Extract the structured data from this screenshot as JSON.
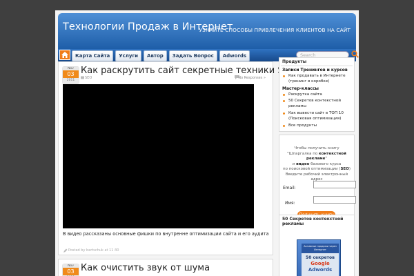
{
  "header": {
    "site_title": "Технологии Продаж в Интернет",
    "tagline": "УЗНАЙТЕ СПОСОБЫ ПРИВЛЕЧЕНИЯ КЛИЕНТОВ НА САЙТ"
  },
  "nav": {
    "items": [
      "Карта Сайта",
      "Услуги",
      "Автор",
      "Задать Вопрос",
      "Adwords"
    ],
    "search_placeholder": "Search"
  },
  "posts": [
    {
      "date": {
        "month": "Nov",
        "day": "03",
        "year": "2011"
      },
      "title": "Как раскрутить сайт секретные техники SEO",
      "tag": "SEO",
      "comments": "No Responses »",
      "excerpt": "В видео рассказаны основные фишки по внутренне оптимизации сайта и его аудита",
      "footer": "Posted by bertschuk at 11:30"
    },
    {
      "date": {
        "month": "Nov",
        "day": "03",
        "year": "2011"
      },
      "title": "Как очистить звук от шума"
    }
  ],
  "sidebar": {
    "products": {
      "title": "Продукты",
      "section1": "Записи Тренингов и курсов",
      "items1": [
        "Как продавать в Интернете (тренинг в коробке)"
      ],
      "section2": "Мастер-классы",
      "items2": [
        "Раскрутка сайта",
        "50 Секретов контекстной рекламы",
        "Как вывести сайт в ТОП 10 (Поисковая оптимизация)",
        "Все продукты"
      ]
    },
    "optin": {
      "line1": "Чтобы получить книгу",
      "line2a": "\"Шпаргалка по ",
      "line2b": "контекстной",
      "line3b": "рекламе",
      "line3a": "\"",
      "line4a": "и ",
      "line4b": "видео",
      "line4c": " базового курса",
      "line5": "по поисковой оптимизации (",
      "line5b": "SEO",
      "line5c": ")",
      "line6": "Введите рабочий электронный адрес",
      "email_label": "Email:",
      "name_label": "Имя:",
      "button": "Получить книгу"
    },
    "book": {
      "title": "50 Секретов контекстной рекламы",
      "cover_top": "Активные продажи через Интернет",
      "cover_num": "50 секретов",
      "cover_g": "Google",
      "cover_a": "Adwords"
    }
  },
  "colors": {
    "accent": "#f07d1a",
    "header_blue": "#2f72c1",
    "background": "#3f3f3f"
  }
}
